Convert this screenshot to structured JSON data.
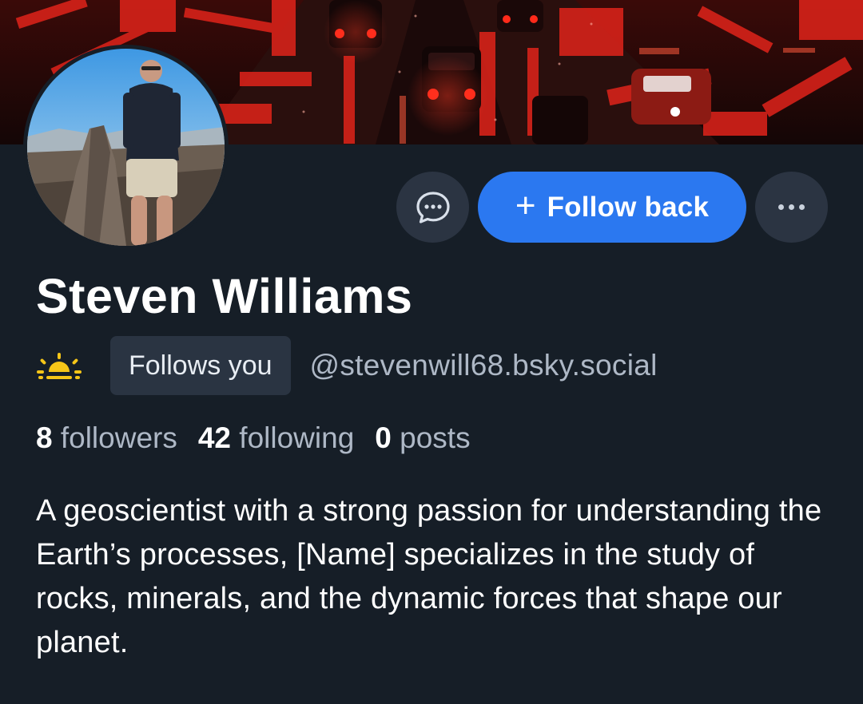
{
  "profile": {
    "display_name": "Steven Williams",
    "follows_you_label": "Follows you",
    "handle": "@stevenwill68.bsky.social",
    "badge_icon": "sunrise-icon",
    "avatar_description": "avatar-photo",
    "banner_description": "banner-image"
  },
  "actions": {
    "message_icon": "chat-bubble-icon",
    "follow_plus": "+",
    "follow_label": "Follow back",
    "more_icon": "ellipsis-icon"
  },
  "stats": [
    {
      "value": "8",
      "label": "followers"
    },
    {
      "value": "42",
      "label": "following"
    },
    {
      "value": "0",
      "label": "posts"
    }
  ],
  "bio": "A geoscientist with a strong passion for understanding the Earth’s processes, [Name] specializes in the study of rocks, minerals, and the dynamic forces that shape our planet.",
  "colors": {
    "background": "#161e27",
    "accent": "#2b78f0",
    "muted_text": "#aeb8c6",
    "pill_bg": "#2a3442",
    "badge": "#f5c518"
  }
}
